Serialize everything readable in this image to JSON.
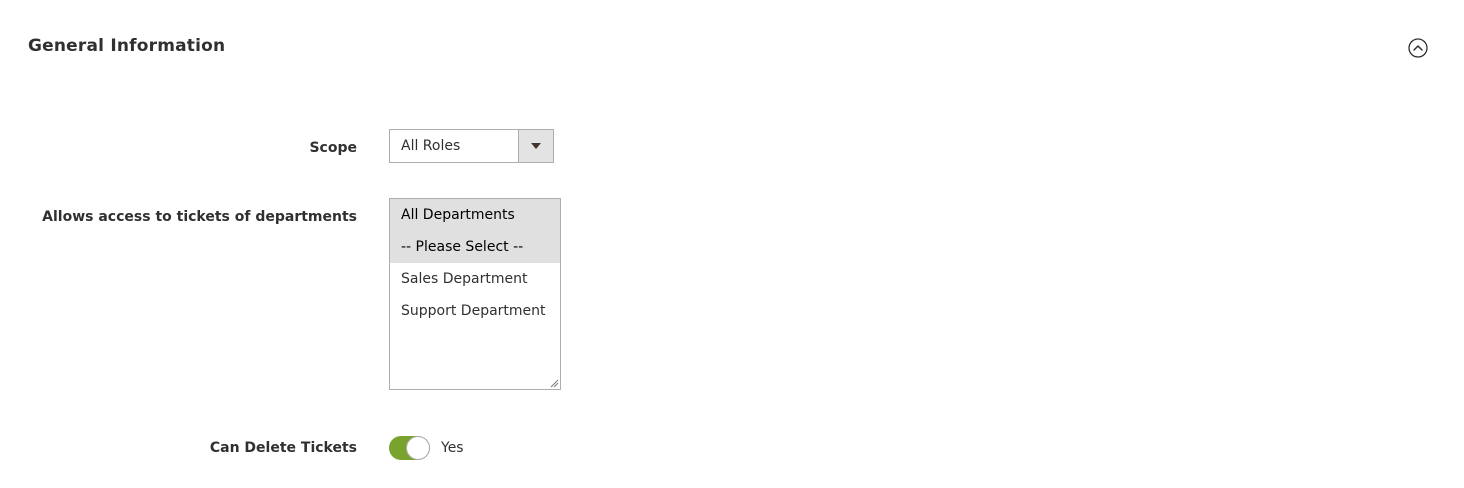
{
  "section": {
    "title": "General Information",
    "collapse_icon": "chevron-up-circle-icon"
  },
  "fields": {
    "scope": {
      "label": "Scope",
      "value": "All Roles",
      "arrow_icon": "triangle-down-icon"
    },
    "departments": {
      "label": "Allows access to tickets of departments",
      "options": [
        {
          "label": "All Departments",
          "selected": true
        },
        {
          "label": "-- Please Select --",
          "selected": true
        },
        {
          "label": "Sales Department",
          "selected": false
        },
        {
          "label": "Support Department",
          "selected": false
        }
      ]
    },
    "can_delete": {
      "label": "Can Delete Tickets",
      "value_label": "Yes",
      "on": true
    }
  },
  "colors": {
    "toggle_on": "#79a22e",
    "selected_option_bg": "#e0e0e0",
    "border": "#adadad"
  }
}
